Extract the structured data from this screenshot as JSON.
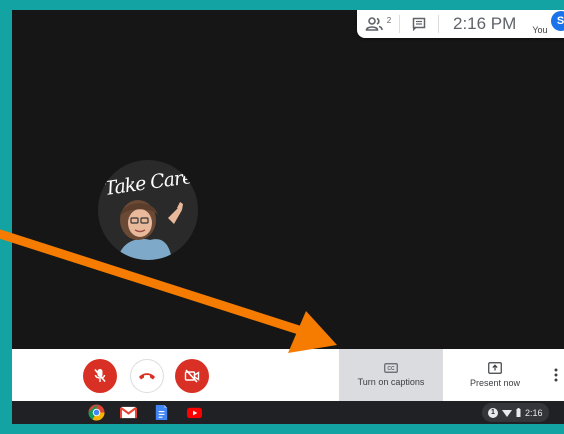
{
  "topbar": {
    "participants_count": "2",
    "people_icon": "people-icon",
    "chat_icon": "chat-icon",
    "time": "2:16 PM",
    "you_label": "You",
    "avatar_initial": "S"
  },
  "video": {
    "bitmoji_text": "Take Care"
  },
  "controls": {
    "mic_icon": "mic-off-icon",
    "hangup_icon": "hang-up-icon",
    "camera_icon": "camera-off-icon",
    "captions_label": "Turn on captions",
    "captions_icon_text": "CC",
    "present_label": "Present now",
    "more_icon": "more-vert-icon"
  },
  "shelf": {
    "apps": [
      "chrome-icon",
      "gmail-icon",
      "docs-icon",
      "youtube-icon"
    ],
    "notification_count": "1",
    "time": "2:16"
  },
  "colors": {
    "frame": "#14a3a3",
    "danger": "#d93025",
    "accent": "#1a73e8",
    "arrow": "#f57c00"
  }
}
